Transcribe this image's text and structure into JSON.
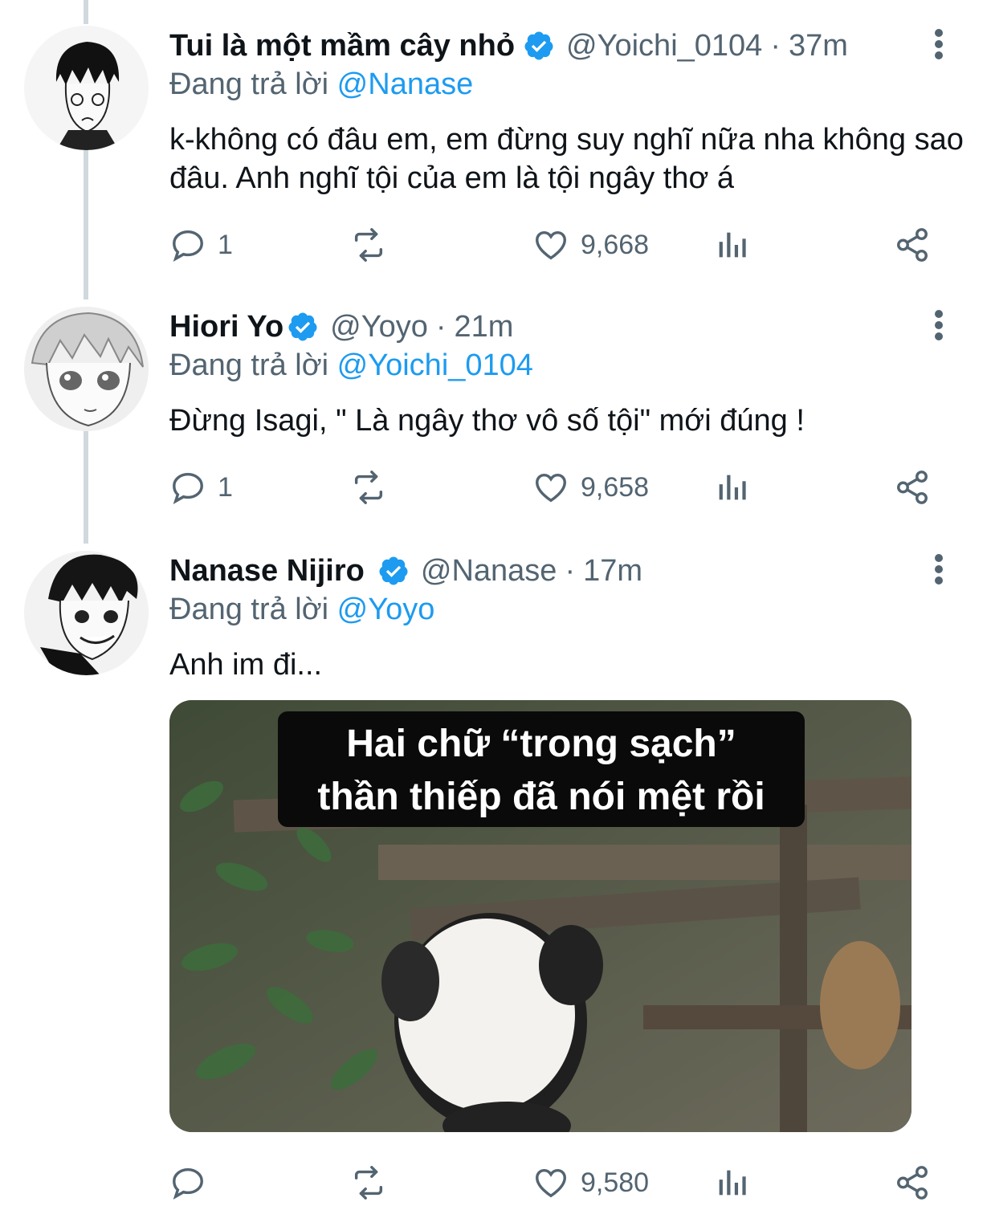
{
  "tweets": [
    {
      "name": "Tui là một mầm cây nhỏ",
      "handle": "@Yoichi_0104",
      "sep": "·",
      "time": "37m",
      "reply_prefix": "Đang trả lời",
      "reply_to": "@Nanase",
      "text": "k-không có đâu em, em đừng suy nghĩ nữa nha không sao đâu. Anh nghĩ tội của em là tội ngây thơ á",
      "replies": "1",
      "likes": "9,668"
    },
    {
      "name": "Hiori Yo",
      "handle": "@Yoyo",
      "sep": "·",
      "time": "21m",
      "reply_prefix": "Đang trả lời",
      "reply_to": "@Yoichi_0104",
      "text": "Đừng Isagi, \" Là ngây thơ vô số tội\" mới đúng !",
      "replies": "1",
      "likes": "9,658"
    },
    {
      "name": "Nanase Nijiro",
      "handle": "@Nanase",
      "sep": "·",
      "time": "17m",
      "reply_prefix": "Đang trả lời",
      "reply_to": "@Yoyo",
      "text": "Anh im đi...",
      "media_caption_line1": "Hai chữ “trong sạch”",
      "media_caption_line2": "thần thiếp đã nói mệt rồi",
      "replies": "",
      "likes": "9,580"
    }
  ],
  "icons": {
    "verified": "verified-badge-icon",
    "more": "more-vertical-icon",
    "reply": "reply-bubble-icon",
    "retweet": "retweet-icon",
    "like": "heart-icon",
    "views": "bar-chart-icon",
    "share": "share-icon"
  },
  "colors": {
    "accent": "#1d9bf0",
    "secondary_text": "#536471",
    "primary_text": "#0f1419",
    "thread_line": "#cfd9de"
  }
}
